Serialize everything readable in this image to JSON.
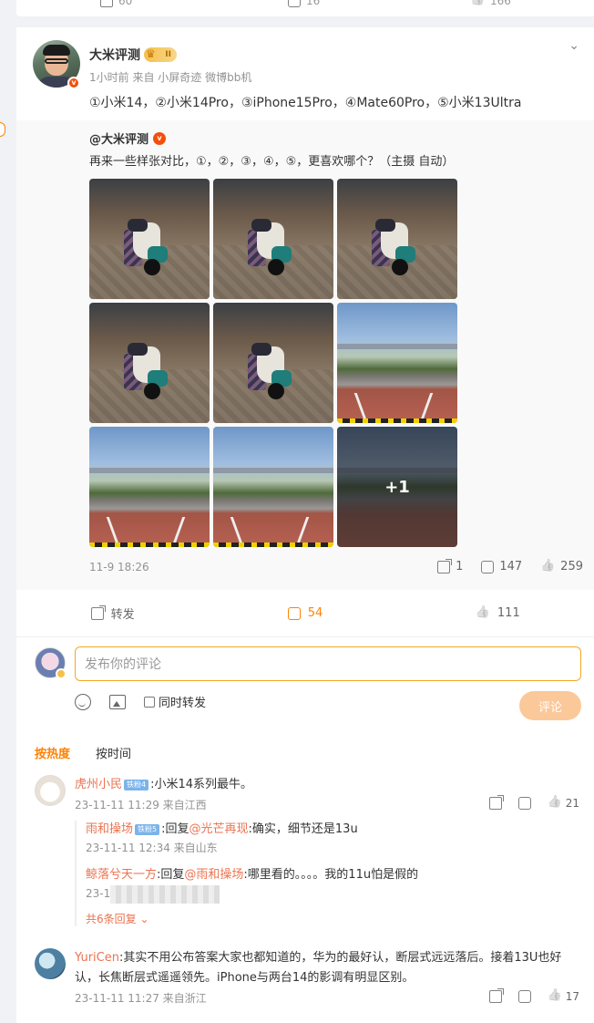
{
  "prev_card": {
    "share_count": "60",
    "comment_count": "16",
    "like_count": "166"
  },
  "post": {
    "author": "大米评测",
    "level_badge": "II",
    "meta": "1小时前  来自 小屏奇迹 微博bb机",
    "text": "①小米14，②小米14Pro，③iPhone15Pro，④Mate60Pro，⑤小米13Ultra",
    "repost": {
      "author": "@大米评测",
      "text": "再来一些样张对比，①，②，③，④，⑤，更喜欢哪个？（主摄 自动）",
      "extra_count": "+1",
      "time": "11-9 18:26",
      "share_count": "1",
      "comment_count": "147",
      "like_count": "259"
    },
    "actions": {
      "repost_label": "转发",
      "comment_count": "54",
      "like_count": "111"
    }
  },
  "composer": {
    "placeholder": "发布你的评论",
    "also_repost_label": "同时转发",
    "submit_label": "评论"
  },
  "sort": {
    "hot": "按热度",
    "time": "按时间"
  },
  "comments": [
    {
      "name": "虎州小民",
      "level": "铁粉4",
      "text": ":小米14系列最牛。",
      "meta": "23-11-11 11:29  来自江西",
      "likes": "21",
      "replies": [
        {
          "name": "雨和操场",
          "level": "铁粉5",
          "pre": ":回复",
          "at": "@光芒再现",
          "text": ":确实，细节还是13u",
          "meta": "23-11-11 12:34  来自山东"
        },
        {
          "name": "鲸落兮天一方",
          "pre": ":回复",
          "at": "@雨和操场",
          "text": ":哪里看的。。。。我的11u怕是假的",
          "meta": "23-1"
        }
      ],
      "more": "共6条回复"
    },
    {
      "name": "YuriCen",
      "text": ":其实不用公布答案大家也都知道的，华为的最好认，断层式远远落后。接着13U也好认，长焦断层式遥遥领先。iPhone与两台14的影调有明显区别。",
      "meta": "23-11-11 11:27  来自浙江",
      "likes": "17"
    }
  ],
  "colors": {
    "accent": "#ff8200",
    "username": "#eb7350",
    "meta": "#939393"
  }
}
